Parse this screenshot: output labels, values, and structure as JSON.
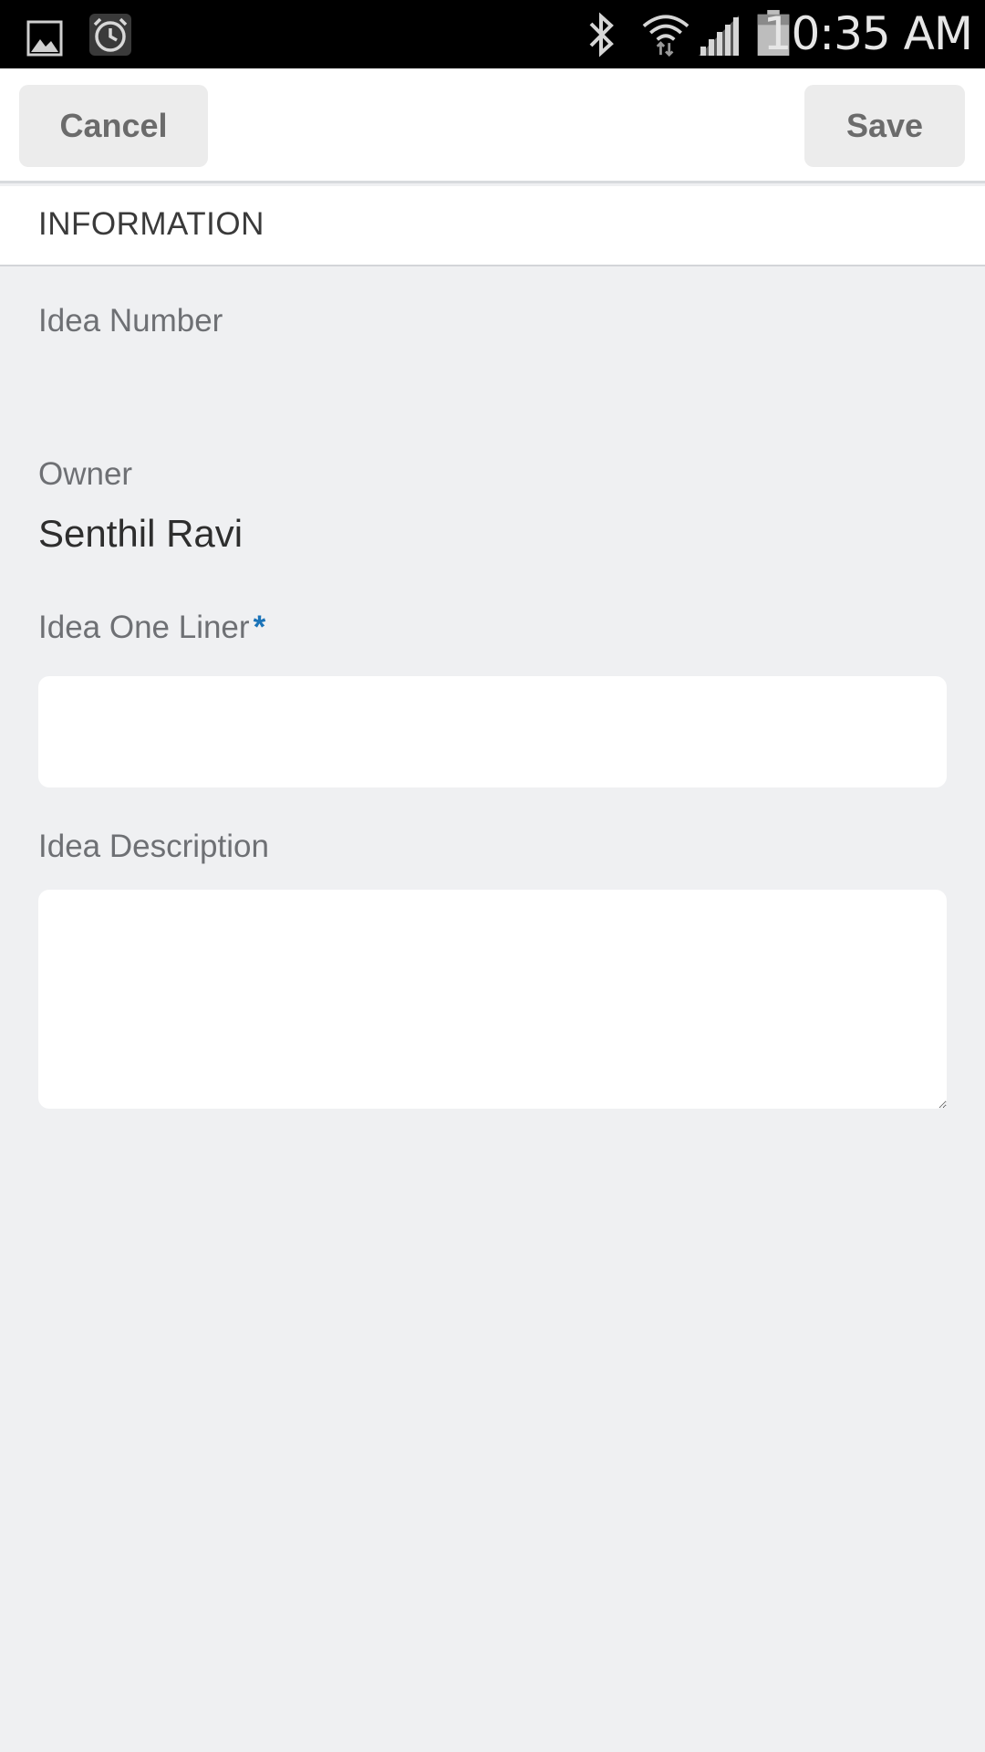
{
  "status_bar": {
    "time": "10:35 AM",
    "icons": [
      "image-icon",
      "alarm-icon",
      "bluetooth-icon",
      "wifi-icon",
      "signal-icon",
      "battery-icon"
    ]
  },
  "toolbar": {
    "cancel_label": "Cancel",
    "save_label": "Save"
  },
  "section": {
    "title": "INFORMATION"
  },
  "form": {
    "idea_number": {
      "label": "Idea Number",
      "value": ""
    },
    "owner": {
      "label": "Owner",
      "value": "Senthil Ravi"
    },
    "idea_one_liner": {
      "label": "Idea One Liner",
      "required_marker": "*",
      "value": ""
    },
    "idea_description": {
      "label": "Idea Description",
      "value": ""
    }
  },
  "colors": {
    "background": "#eff0f2",
    "required": "#1a73b8",
    "button_bg": "#ececec"
  }
}
